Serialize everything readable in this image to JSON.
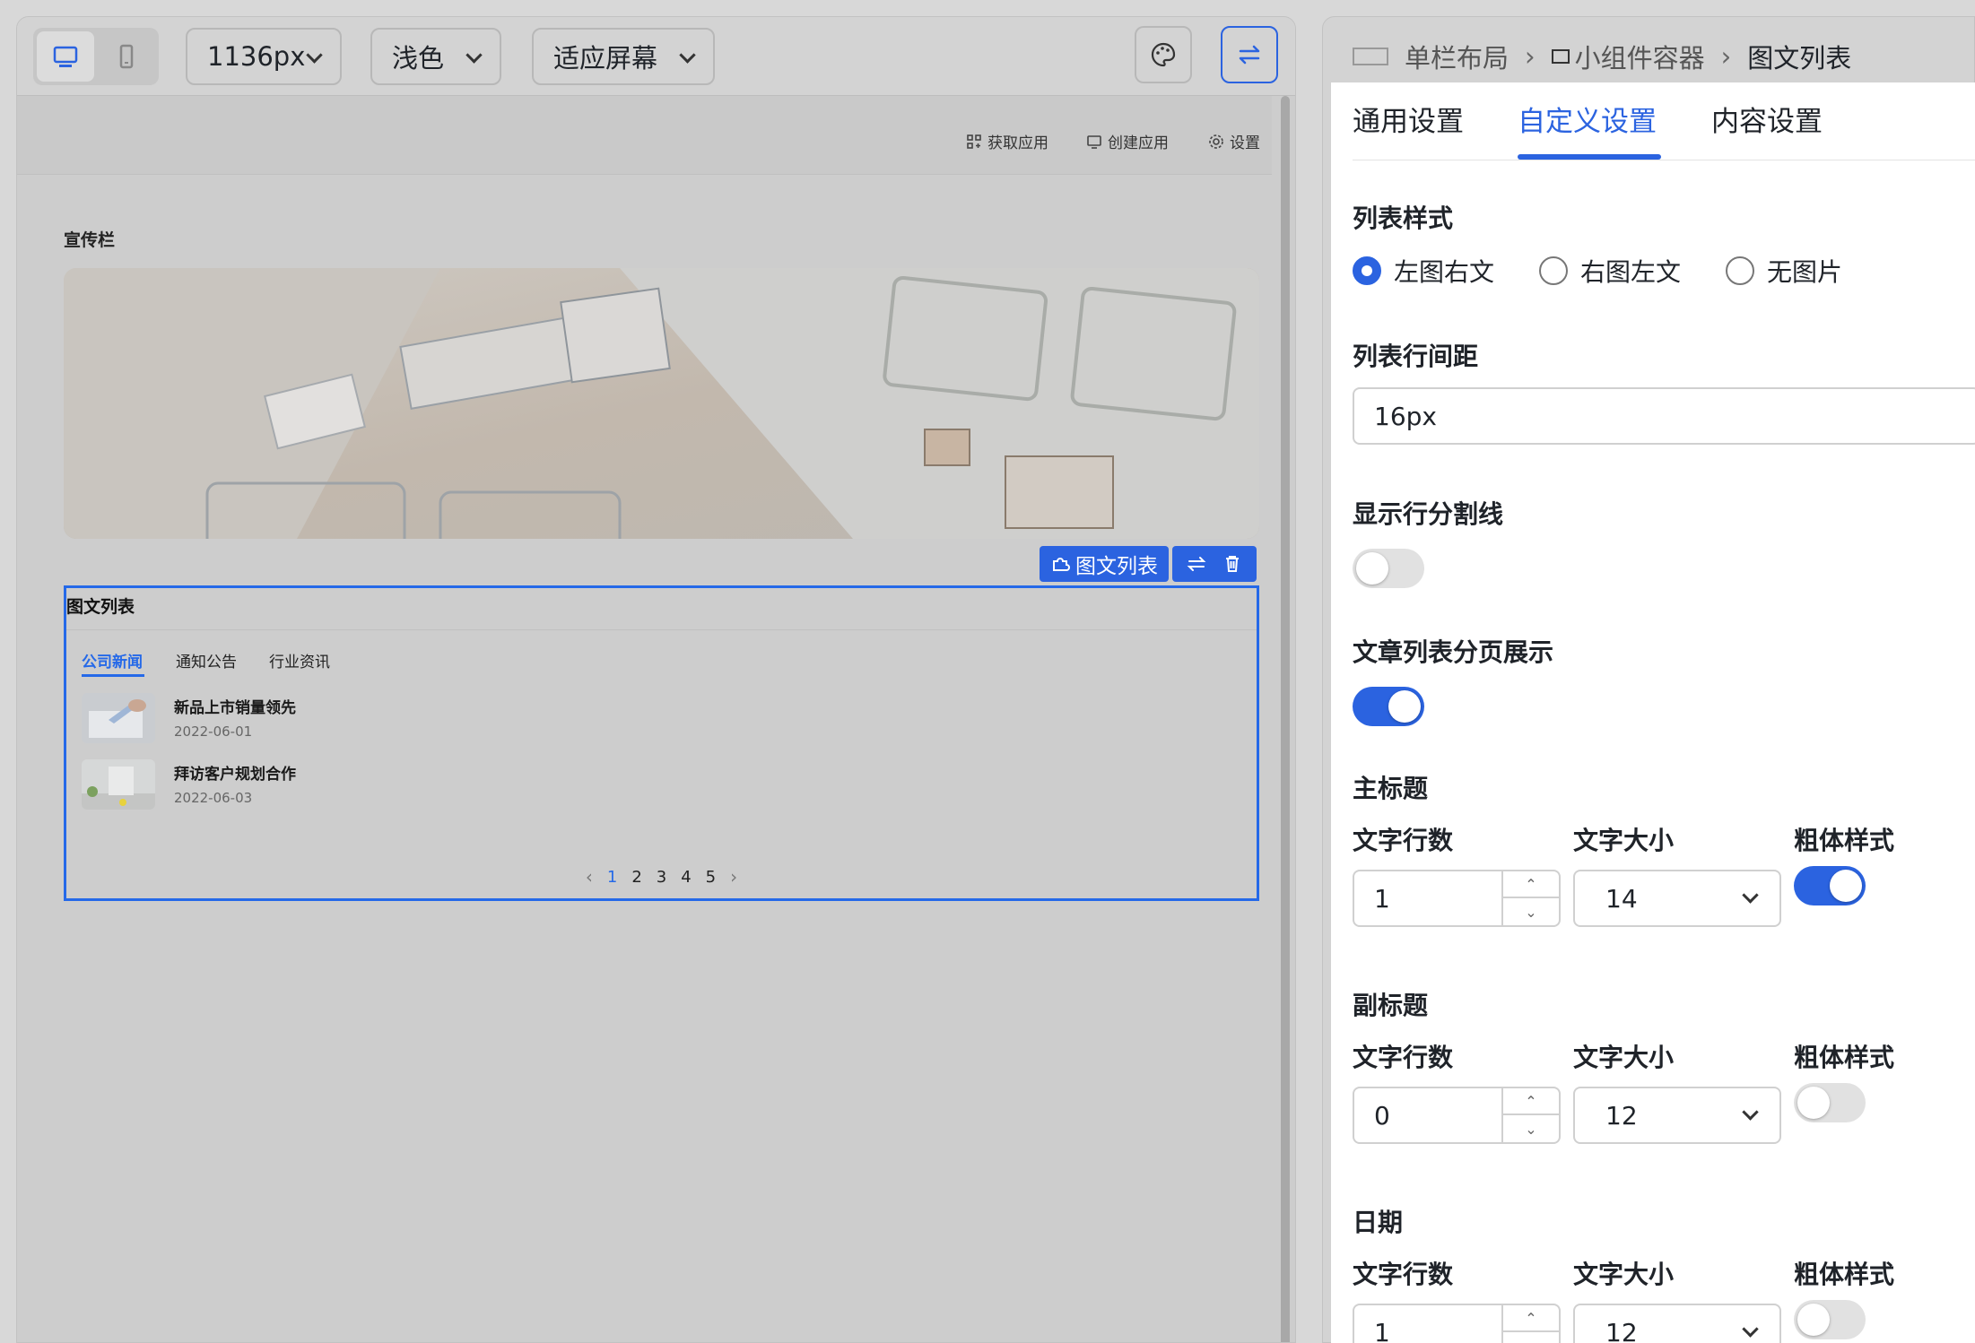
{
  "toolbar": {
    "width_value": "1136px",
    "theme_value": "浅色",
    "fit_value": "适应屏幕"
  },
  "canvas": {
    "top_links": [
      "获取应用",
      "创建应用",
      "设置"
    ],
    "banner_label": "宣传栏",
    "selected_widget_tag": "图文列表"
  },
  "widget": {
    "title": "图文列表",
    "tabs": [
      "公司新闻",
      "通知公告",
      "行业资讯"
    ],
    "items": [
      {
        "title": "新品上市销量领先",
        "date": "2022-06-01"
      },
      {
        "title": "拜访客户规划合作",
        "date": "2022-06-03"
      }
    ],
    "pages": [
      "1",
      "2",
      "3",
      "4",
      "5"
    ],
    "current_page": "1"
  },
  "breadcrumb": [
    "单栏布局",
    "小组件容器",
    "图文列表"
  ],
  "panel": {
    "tabs": [
      "通用设置",
      "自定义设置",
      "内容设置"
    ],
    "active_tab": "自定义设置",
    "list_style_label": "列表样式",
    "list_style_options": [
      "左图右文",
      "右图左文",
      "无图片"
    ],
    "list_style_selected": "左图右文",
    "row_spacing_label": "列表行间距",
    "row_spacing_value": "16px",
    "divider_label": "显示行分割线",
    "divider_on": false,
    "paging_label": "文章列表分页展示",
    "paging_on": true,
    "col_lines": "文字行数",
    "col_size": "文字大小",
    "col_bold": "粗体样式",
    "main_title": {
      "label": "主标题",
      "lines": "1",
      "size": "14",
      "bold": true
    },
    "sub_title": {
      "label": "副标题",
      "lines": "0",
      "size": "12",
      "bold": false
    },
    "date": {
      "label": "日期",
      "lines": "1",
      "size": "12",
      "bold": false
    }
  }
}
